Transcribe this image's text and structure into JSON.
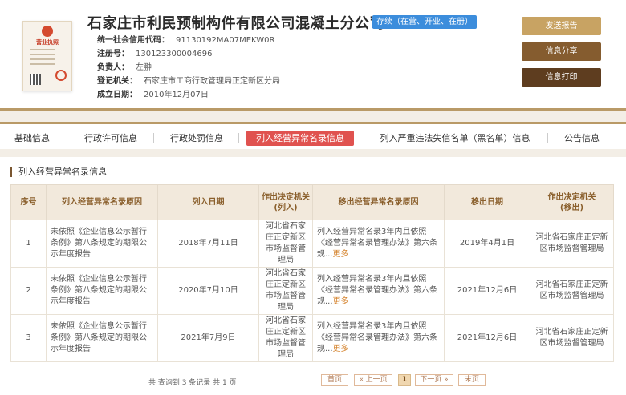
{
  "license_icon": {
    "title": "营业执照",
    "icon": "business-license-icon"
  },
  "company": {
    "name": "石家庄市利民预制构件有限公司混凝土分公司",
    "status": "存续（在营、开业、在册）"
  },
  "info": [
    {
      "label": "统一社会信用代码：",
      "value": "91130192MA07MEKW0R"
    },
    {
      "label": "注册号：",
      "value": "130123300004696"
    },
    {
      "label": "负责人：",
      "value": "左翀"
    },
    {
      "label": "登记机关：",
      "value": "石家庄市工商行政管理局正定新区分局"
    },
    {
      "label": "成立日期：",
      "value": "2010年12月07日"
    }
  ],
  "actions": {
    "report": "发送报告",
    "share": "信息分享",
    "print": "信息打印"
  },
  "tabs": [
    {
      "label": "基础信息"
    },
    {
      "label": "行政许可信息"
    },
    {
      "label": "行政处罚信息"
    },
    {
      "label": "列入经营异常名录信息"
    },
    {
      "label": "列入严重违法失信名单（黑名单）信息"
    },
    {
      "label": "公告信息"
    }
  ],
  "section": {
    "title": "列入经营异常名录信息"
  },
  "table": {
    "headers": [
      "序号",
      "列入经营异常名录原因",
      "列入日期",
      "作出决定机关\n(列入)",
      "移出经营异常名录原因",
      "移出日期",
      "作出决定机关\n(移出)"
    ],
    "rows": [
      {
        "no": "1",
        "reason": "未依照《企业信息公示暂行条例》第八条规定的期限公示年度报告",
        "date_in": "2018年7月11日",
        "org_in": "河北省石家庄正定新区市场监督管理局",
        "remove_reason": "列入经营异常名录3年内且依照《经营异常名录管理办法》第六条规...",
        "more": "更多",
        "date_out": "2019年4月1日",
        "org_out": "河北省石家庄正定新区市场监督管理局"
      },
      {
        "no": "2",
        "reason": "未依照《企业信息公示暂行条例》第八条规定的期限公示年度报告",
        "date_in": "2020年7月10日",
        "org_in": "河北省石家庄正定新区市场监督管理局",
        "remove_reason": "列入经营异常名录3年内且依照《经营异常名录管理办法》第六条规...",
        "more": "更多",
        "date_out": "2021年12月6日",
        "org_out": "河北省石家庄正定新区市场监督管理局"
      },
      {
        "no": "3",
        "reason": "未依照《企业信息公示暂行条例》第八条规定的期限公示年度报告",
        "date_in": "2021年7月9日",
        "org_in": "河北省石家庄正定新区市场监督管理局",
        "remove_reason": "列入经营异常名录3年内且依照《经营异常名录管理办法》第六条规...",
        "more": "更多",
        "date_out": "2021年12月6日",
        "org_out": "河北省石家庄正定新区市场监督管理局"
      }
    ]
  },
  "pager": {
    "summary": "共 查询到 3 条记录 共 1 页",
    "first": "首页",
    "prev": "« 上一页",
    "current": "1",
    "next": "下一页 »",
    "last": "末页"
  }
}
